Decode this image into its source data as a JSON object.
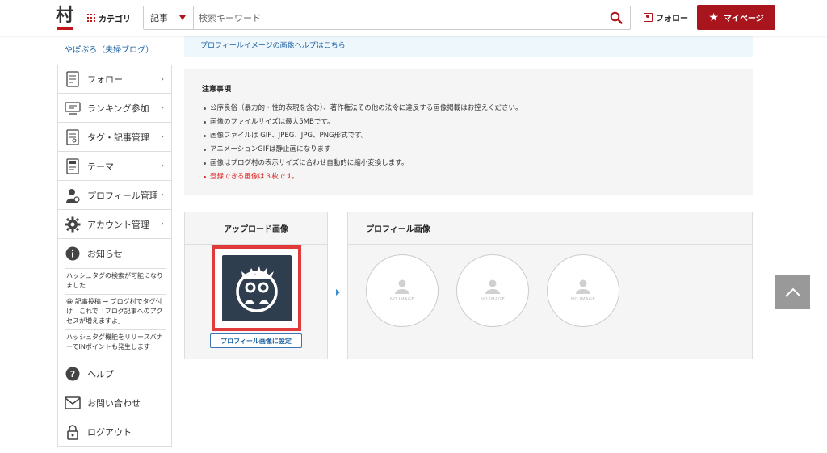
{
  "header": {
    "logo_text": "村",
    "category_label": "カテゴリ",
    "search_select": "記事",
    "search_placeholder": "検索キーワード",
    "follow_label": "フォロー",
    "mypage_label": "マイページ",
    "brand_color": "#a8151d"
  },
  "sidebar": {
    "blog_name": "やぽぷろ（夫婦ブログ）",
    "items": [
      {
        "label": "フォロー",
        "icon": "follow-card-icon"
      },
      {
        "label": "ランキング参加",
        "icon": "ranking-icon"
      },
      {
        "label": "タグ・記事管理",
        "icon": "tag-article-icon"
      },
      {
        "label": "テーマ",
        "icon": "theme-icon"
      },
      {
        "label": "プロフィール管理",
        "icon": "profile-user-icon"
      },
      {
        "label": "アカウント管理",
        "icon": "gear-icon"
      }
    ],
    "notice_label": "お知らせ",
    "news": [
      "ハッシュタグの検索が可能になりました",
      "😀 記事投稿 → ブログ村でタグ付け　これで「ブログ記事へのアクセスが増えますよ」",
      "ハッシュタグ機能をリリースバナーでINポイントも発生します"
    ],
    "bottom_items": [
      {
        "label": "ヘルプ",
        "icon": "help-icon"
      },
      {
        "label": "お問い合わせ",
        "icon": "mail-icon"
      },
      {
        "label": "ログアウト",
        "icon": "lock-icon"
      }
    ]
  },
  "main": {
    "help_link": "プロフィールイメージの画像ヘルプはこちら",
    "caution_title": "注意事項",
    "caution_items": [
      "公序良俗（暴力的・性的表現を含む）、著作権法その他の法令に違反する画像掲載はお控えください。",
      "画像のファイルサイズは最大5MBです。",
      "画像ファイルは GIF、JPEG、JPG、PNG形式です。",
      "アニメーションGIFは静止画になります",
      "画像はブログ村の表示サイズに合わせ自動的に縮小変換します。"
    ],
    "caution_red": "登録できる画像は３枚です。",
    "upload_title": "アップロード画像",
    "set_button": "プロフィール画像に設定",
    "profile_title": "プロフィール画像",
    "slots": [
      "NO IMAGE",
      "NO IMAGE",
      "NO IMAGE"
    ]
  }
}
